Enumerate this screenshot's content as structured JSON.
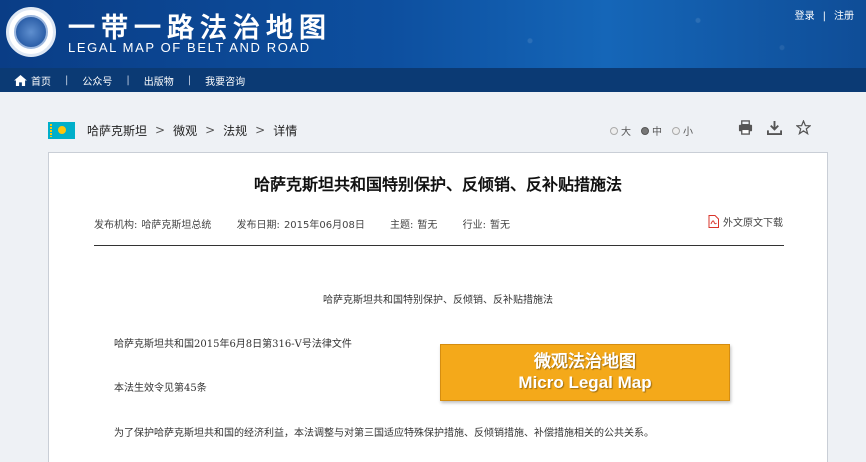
{
  "header": {
    "title_cn": "一带一路法治地图",
    "title_en": "LEGAL MAP OF BELT AND ROAD",
    "login": "登录",
    "separator": "|",
    "register": "注册"
  },
  "nav": {
    "items": [
      {
        "label": "首页"
      },
      {
        "label": "公众号"
      },
      {
        "label": "出版物"
      },
      {
        "label": "我要咨询"
      }
    ],
    "separator": "|"
  },
  "breadcrumb": {
    "items": [
      "哈萨克斯坦",
      "微观",
      "法规",
      "详情"
    ],
    "separator": ">"
  },
  "font_size": {
    "options": [
      "大",
      "中",
      "小"
    ],
    "selected": "中"
  },
  "tools": [
    "print-icon",
    "download-icon",
    "star-icon"
  ],
  "article": {
    "title": "哈萨克斯坦共和国特别保护、反倾销、反补贴措施法",
    "meta": {
      "org_label": "发布机构:",
      "org_value": "哈萨克斯坦总统",
      "date_label": "发布日期:",
      "date_value": "2015年06月08日",
      "topic_label": "主题:",
      "topic_value": "暂无",
      "industry_label": "行业:",
      "industry_value": "暂无"
    },
    "download_label": "外文原文下载",
    "doc_heading": "哈萨克斯坦共和国特别保护、反倾销、反补贴措施法",
    "paragraphs": [
      "哈萨克斯坦共和国2015年6月8日第316-V号法律文件",
      "本法生效令见第45条",
      "为了保护哈萨克斯坦共和国的经济利益，本法调整与对第三国适应特殊保护措施、反倾销措施、补偿措施相关的公共关系。"
    ]
  },
  "banner": {
    "cn": "微观法治地图",
    "en": "Micro Legal Map"
  },
  "colors": {
    "header": "#0d4f9f",
    "nav": "#0b3a74",
    "banner": "#f4a91a",
    "flag": "#00afca"
  }
}
